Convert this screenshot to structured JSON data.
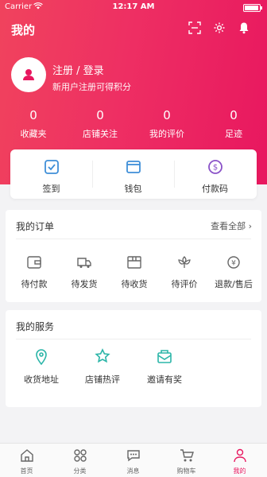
{
  "status": {
    "carrier": "Carrier",
    "time": "12:17 AM"
  },
  "header": {
    "title": "我的"
  },
  "profile": {
    "login": "注册 / 登录",
    "subtitle": "新用户注册可得积分"
  },
  "stats": [
    {
      "value": "0",
      "label": "收藏夹"
    },
    {
      "value": "0",
      "label": "店铺关注"
    },
    {
      "value": "0",
      "label": "我的评价"
    },
    {
      "value": "0",
      "label": "足迹"
    }
  ],
  "quick": [
    {
      "label": "签到",
      "icon": "checkin-icon"
    },
    {
      "label": "钱包",
      "icon": "wallet-icon"
    },
    {
      "label": "付款码",
      "icon": "pay-code-icon"
    }
  ],
  "orders": {
    "title": "我的订单",
    "see_all": "查看全部",
    "items": [
      {
        "label": "待付款",
        "icon": "wallet-outline-icon"
      },
      {
        "label": "待发货",
        "icon": "truck-icon"
      },
      {
        "label": "待收货",
        "icon": "package-icon"
      },
      {
        "label": "待评价",
        "icon": "flower-icon"
      },
      {
        "label": "退款/售后",
        "icon": "refund-icon"
      }
    ]
  },
  "services": {
    "title": "我的服务",
    "items": [
      {
        "label": "收货地址",
        "icon": "location-icon"
      },
      {
        "label": "店铺热评",
        "icon": "star-icon"
      },
      {
        "label": "邀请有奖",
        "icon": "gift-mail-icon"
      }
    ]
  },
  "tabbar": [
    {
      "label": "首页",
      "icon": "home-icon"
    },
    {
      "label": "分类",
      "icon": "category-icon"
    },
    {
      "label": "消息",
      "icon": "message-icon"
    },
    {
      "label": "购物车",
      "icon": "cart-icon"
    },
    {
      "label": "我的",
      "icon": "profile-icon",
      "active": true
    }
  ],
  "colors": {
    "brand": "#e8175f",
    "quick_icon": "#3f8fd8",
    "service_icon": "#2bb5a8"
  }
}
